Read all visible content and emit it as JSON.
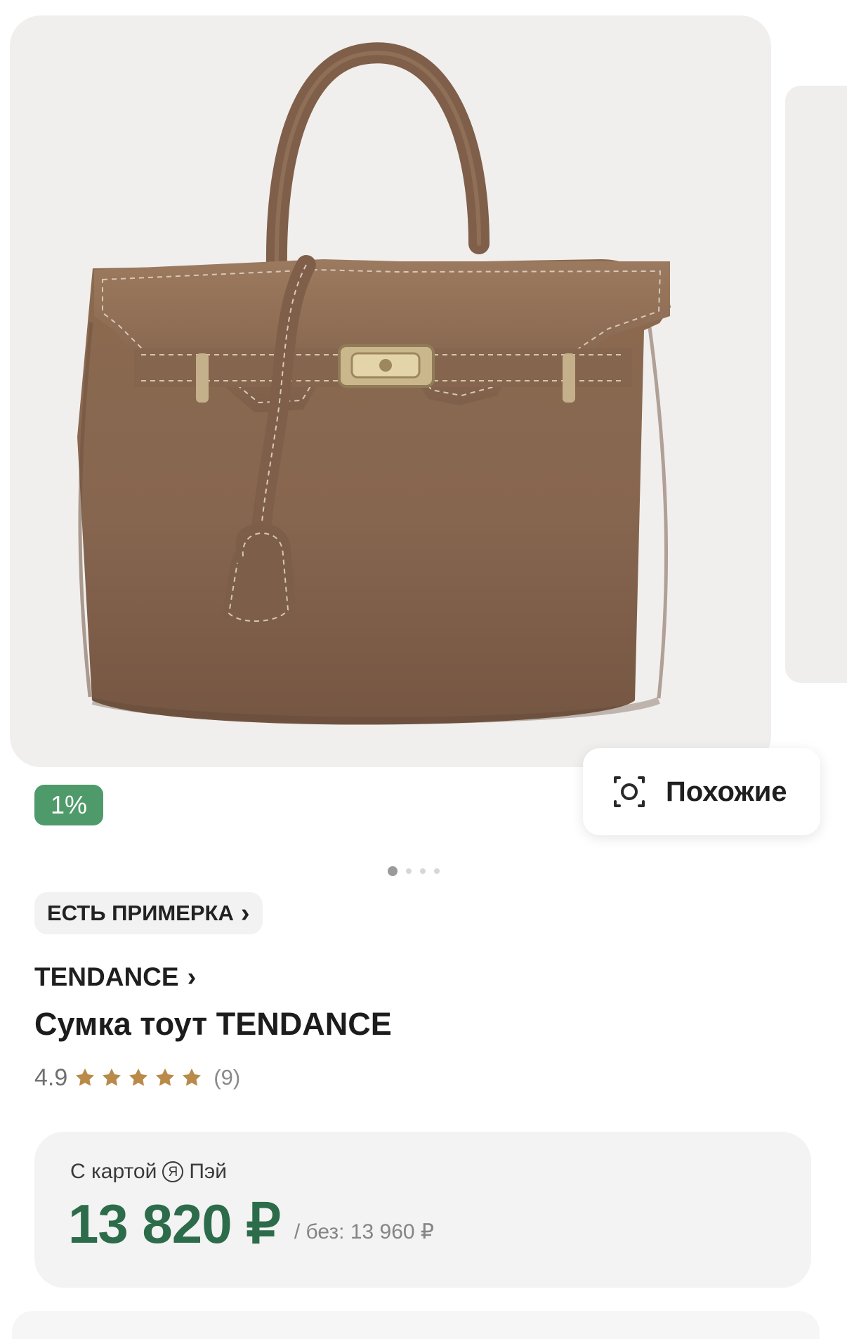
{
  "gallery": {
    "image_icon": "product-image",
    "dots_count": 4,
    "active_dot": 1,
    "colors": {
      "background": "#f1efed",
      "bag": "#8d6a4f",
      "bag_dark": "#6f523f",
      "hardware": "#c8b488"
    }
  },
  "badges": {
    "cashback": "1%",
    "similar_label": "Похожие",
    "similar_icon": "similar-search-icon"
  },
  "product": {
    "tryon_label": "ЕСТЬ ПРИМЕРКА",
    "brand": "TENDANCE",
    "title": "Сумка тоут TENDANCE",
    "rating": "4.9",
    "stars": 5,
    "reviews": "(9)"
  },
  "pricing": {
    "payment_label_prefix": "С картой",
    "payment_icon": "ya-pay-icon",
    "payment_label_suffix": "Пэй",
    "current_price": "13 820 ₽",
    "old_price_label": "/ без: 13 960 ₽"
  },
  "theme": {
    "green": "#4f9a6a",
    "price_green": "#2c6c4a",
    "star_color": "#b98a49"
  }
}
